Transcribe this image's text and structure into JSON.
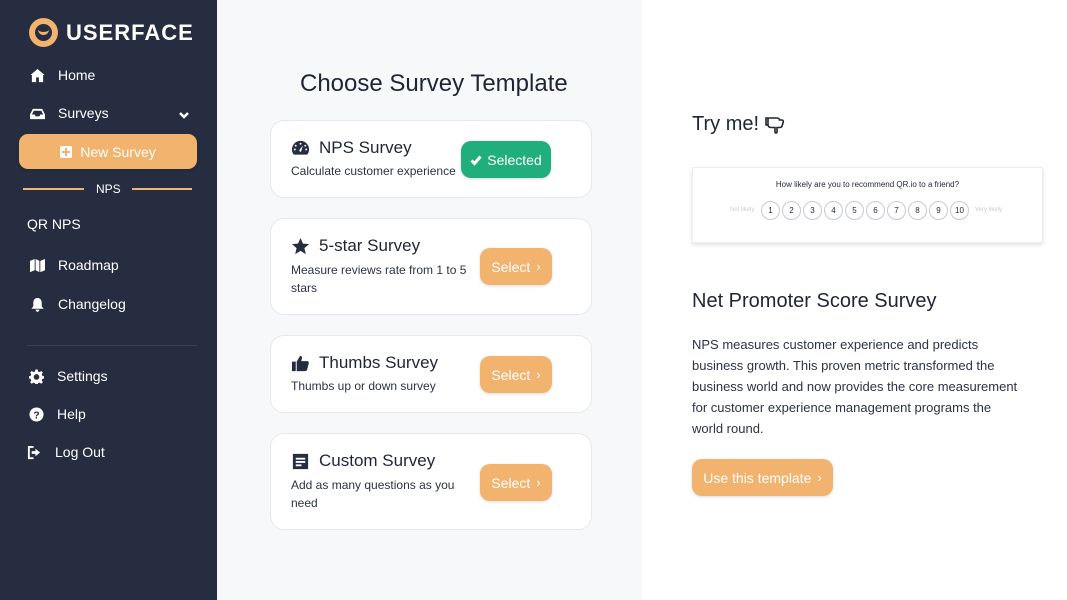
{
  "brand": {
    "name": "USERFACE",
    "accent": "#f2b36e",
    "sidebar_bg": "#272d40",
    "success": "#1fae7c"
  },
  "sidebar": {
    "home": "Home",
    "surveys": "Surveys",
    "new_survey": "New Survey",
    "section_label": "NPS",
    "qr_nps": "QR NPS",
    "roadmap": "Roadmap",
    "changelog": "Changelog",
    "settings": "Settings",
    "help": "Help",
    "logout": "Log Out"
  },
  "templates": {
    "heading": "Choose Survey Template",
    "cards": [
      {
        "title": "NPS Survey",
        "description": "Calculate customer experience",
        "button": "Selected",
        "icon": "gauge-icon",
        "state": "selected"
      },
      {
        "title": "5-star Survey",
        "description": "Measure reviews rate from 1 to 5 stars",
        "button": "Select",
        "icon": "star-icon",
        "state": "available"
      },
      {
        "title": "Thumbs Survey",
        "description": "Thumbs up or down survey",
        "button": "Select",
        "icon": "thumbs-up-icon",
        "state": "available"
      },
      {
        "title": "Custom Survey",
        "description": "Add as many questions as you need",
        "button": "Select",
        "icon": "list-icon",
        "state": "available"
      }
    ]
  },
  "preview": {
    "try_me": "Try me!",
    "question": "How likely are you to recommend QR.io to a friend?",
    "low_label": "Not likely",
    "high_label": "Very likely",
    "scale": [
      "1",
      "2",
      "3",
      "4",
      "5",
      "6",
      "7",
      "8",
      "9",
      "10"
    ]
  },
  "detail": {
    "title": "Net Promoter Score Survey",
    "description": "NPS measures customer experience and predicts business growth. This proven metric transformed the business world and now provides the core measurement for customer experience management programs the world round.",
    "cta": "Use this template"
  }
}
